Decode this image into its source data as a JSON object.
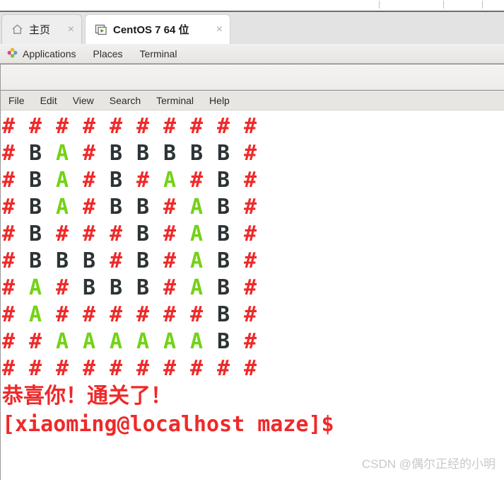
{
  "vm_app": {
    "tabs": [
      {
        "label": "主页",
        "icon": "home-icon",
        "active": false,
        "close_label": "×"
      },
      {
        "label": "CentOS 7 64 位",
        "icon": "vm-play-icon",
        "active": true,
        "close_label": "×"
      }
    ],
    "topstrip_tick_positions": [
      536,
      627,
      682
    ]
  },
  "gnome_panel": {
    "app_menu_icon": "applications-icon",
    "items": [
      {
        "label": "Applications"
      },
      {
        "label": "Places"
      },
      {
        "label": "Terminal"
      }
    ]
  },
  "terminal": {
    "menubar": [
      {
        "label": "File"
      },
      {
        "label": "Edit"
      },
      {
        "label": "View"
      },
      {
        "label": "Search"
      },
      {
        "label": "Terminal"
      },
      {
        "label": "Help"
      }
    ],
    "colors": {
      "wall": "#ef2929",
      "path": "#2e3436",
      "route": "#73d216",
      "background": "#ffffff"
    },
    "maze": {
      "rows": 11,
      "cols": 10,
      "legend": {
        "#": "wall",
        "B": "open-cell",
        "A": "solution-path"
      },
      "grid": [
        [
          "#",
          "#",
          "#",
          "#",
          "#",
          "#",
          "#",
          "#",
          "#",
          "#"
        ],
        [
          "#",
          "B",
          "A",
          "#",
          "B",
          "B",
          "B",
          "B",
          "B",
          "#"
        ],
        [
          "#",
          "B",
          "A",
          "#",
          "B",
          "#",
          "A",
          "#",
          "B",
          "#"
        ],
        [
          "#",
          "B",
          "A",
          "#",
          "B",
          "B",
          "#",
          "A",
          "B",
          "#"
        ],
        [
          "#",
          "B",
          "#",
          "#",
          "#",
          "B",
          "#",
          "A",
          "B",
          "#"
        ],
        [
          "#",
          "B",
          "B",
          "B",
          "#",
          "B",
          "#",
          "A",
          "B",
          "#"
        ],
        [
          "#",
          "A",
          "#",
          "B",
          "B",
          "B",
          "#",
          "A",
          "B",
          "#"
        ],
        [
          "#",
          "A",
          "#",
          "#",
          "#",
          "#",
          "#",
          "#",
          "B",
          "#"
        ],
        [
          "#",
          "#",
          "A",
          "A",
          "A",
          "A",
          "A",
          "A",
          "B",
          "#"
        ],
        [
          "#",
          "#",
          "#",
          "#",
          "#",
          "#",
          "#",
          "#",
          "#",
          "#"
        ]
      ]
    },
    "win_message": "恭喜你！通关了！",
    "prompt": "[xiaoming@localhost maze]$"
  },
  "watermark": {
    "text": "CSDN @偶尔正经的小明"
  }
}
